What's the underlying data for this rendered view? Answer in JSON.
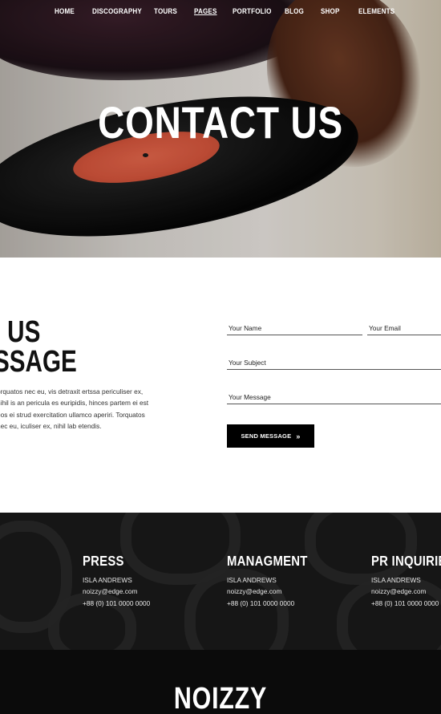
{
  "nav": {
    "items": [
      {
        "label": "HOME"
      },
      {
        "label": "DISCOGRAPHY"
      },
      {
        "label": "TOURS"
      },
      {
        "label": "PAGES"
      },
      {
        "label": "PORTFOLIO"
      },
      {
        "label": "BLOG"
      },
      {
        "label": "SHOP"
      },
      {
        "label": "ELEMENTS"
      }
    ],
    "active": "PAGES"
  },
  "hero": {
    "title": "CONTACT US"
  },
  "contact": {
    "heading_line1": "US",
    "heading_line2": "SSAGE",
    "paragraph": "orquatos nec eu, vis detraxit ertssa periculiser ex, nihil is an pericula es euripidis, hinces partem ei est eos ei strud exercitation ullamco aperiri. Torquatos nec eu, iculiser ex, nihil lab etendis.",
    "form": {
      "name_placeholder": "Your Name",
      "email_placeholder": "Your Email",
      "subject_placeholder": "Your Subject",
      "message_placeholder": "Your Message",
      "send_label": "SEND MESSAGE",
      "send_icon": "double-chevron-right-icon"
    }
  },
  "info": {
    "columns": [
      {
        "title": "PRESS",
        "name": "ISLA ANDREWS",
        "email": "noizzy@edge.com",
        "phone": "+88 (0) 101 0000 0000"
      },
      {
        "title": "MANAGMENT",
        "name": "ISLA ANDREWS",
        "email": "noizzy@edge.com",
        "phone": "+88 (0) 101 0000 0000"
      },
      {
        "title": "PR INQUIRIES",
        "name": "ISLA ANDREWS",
        "email": "noizzy@edge.com",
        "phone": "+88 (0) 101 0000 0000"
      }
    ]
  },
  "footer": {
    "brand": "NOIZZY"
  },
  "colors": {
    "dark_section": "#161616",
    "footer_bg": "#0b0b0b",
    "button_bg": "#000000",
    "record_label": "#d4553c"
  }
}
